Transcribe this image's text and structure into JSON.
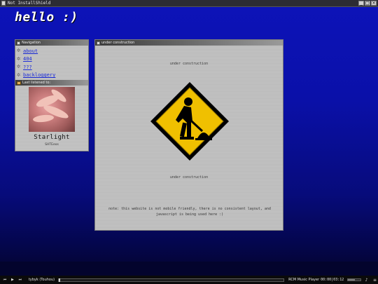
{
  "window": {
    "title": "Not InstallShield"
  },
  "page": {
    "heading": "hello :)",
    "nav_title": "Navigation",
    "nav_items": [
      {
        "label": "about"
      },
      {
        "label": "404"
      },
      {
        "label": "???"
      },
      {
        "label": "backloggery"
      }
    ],
    "last_listened": {
      "title": "Last listened to:",
      "song": "Starlight",
      "artist": "SHTEeos"
    },
    "main": {
      "title": "under construction",
      "text_top": "under construction",
      "text_bottom": "under construction",
      "note": "note: this website is not mobile friendly, there is no consistent layout, and javascript is being used here :)"
    }
  },
  "player": {
    "track": "tybyk (Touhou)",
    "name": "RCM Music Player",
    "time": "00:00|03:12",
    "progress": 0.0,
    "volume": 0.55
  },
  "icons": {
    "nav_bullet": "star-icon",
    "sign": "construction-sign-icon",
    "accent": "#0d13b8",
    "link": "#1a2ad8"
  }
}
